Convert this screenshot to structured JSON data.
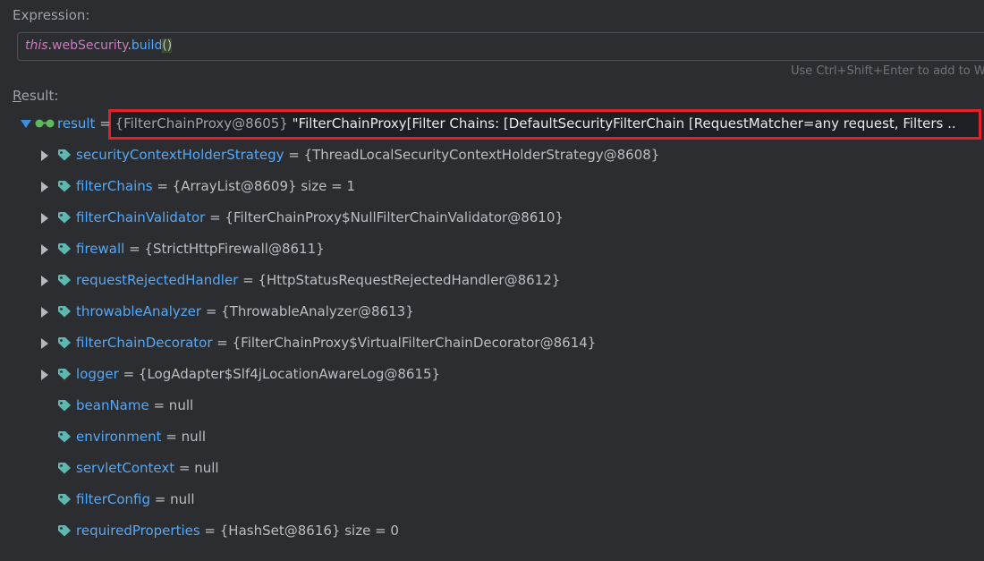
{
  "expression": {
    "label_prefix": "Expression:",
    "code_this": "this",
    "code_dot1": ".",
    "code_field": "webSecurity",
    "code_dot2": ".",
    "code_method": "build",
    "code_parens": "()",
    "hint": "Use Ctrl+Shift+Enter to add to W"
  },
  "result": {
    "label_underlined": "R",
    "label_rest": "esult:",
    "root": {
      "name": "result",
      "eq": " = ",
      "type": "{FilterChainProxy@8605}",
      "value": " \"FilterChainProxy[Filter Chains: [DefaultSecurityFilterChain [RequestMatcher=any request, Filters .."
    },
    "children": [
      {
        "name": "securityContextHolderStrategy",
        "value": " = {ThreadLocalSecurityContextHolderStrategy@8608}",
        "expandable": true
      },
      {
        "name": "filterChains",
        "value": " = {ArrayList@8609}  size = 1",
        "expandable": true
      },
      {
        "name": "filterChainValidator",
        "value": " = {FilterChainProxy$NullFilterChainValidator@8610}",
        "expandable": true
      },
      {
        "name": "firewall",
        "value": " = {StrictHttpFirewall@8611}",
        "expandable": true
      },
      {
        "name": "requestRejectedHandler",
        "value": " = {HttpStatusRequestRejectedHandler@8612}",
        "expandable": true
      },
      {
        "name": "throwableAnalyzer",
        "value": " = {ThrowableAnalyzer@8613}",
        "expandable": true
      },
      {
        "name": "filterChainDecorator",
        "value": " = {FilterChainProxy$VirtualFilterChainDecorator@8614}",
        "expandable": true
      },
      {
        "name": "logger",
        "value": " = {LogAdapter$Slf4jLocationAwareLog@8615}",
        "expandable": true
      },
      {
        "name": "beanName",
        "value": " = null",
        "expandable": false
      },
      {
        "name": "environment",
        "value": " = null",
        "expandable": false
      },
      {
        "name": "servletContext",
        "value": " = null",
        "expandable": false
      },
      {
        "name": "filterConfig",
        "value": " = null",
        "expandable": false
      },
      {
        "name": "requiredProperties",
        "value": " = {HashSet@8616}  size = 0",
        "expandable": false
      }
    ]
  },
  "colors": {
    "background": "#2b2d30",
    "name": "#56a8f5",
    "tag_icon": "#5fb8b0",
    "highlight_border": "#e5202c"
  }
}
